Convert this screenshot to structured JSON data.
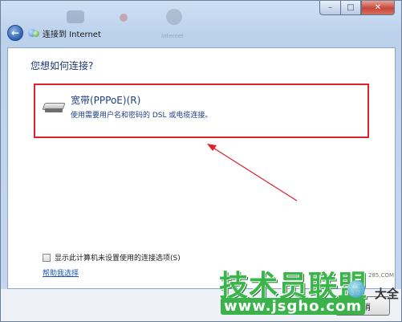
{
  "window": {
    "title": "连接到 Internet",
    "bg_label": "Internet",
    "controls": {
      "minimize": "–",
      "maximize": "□",
      "close": "✕"
    }
  },
  "nav": {
    "back_icon": "back-arrow-icon",
    "back_glyph": "←"
  },
  "content": {
    "question": "您想如何连接?",
    "option": {
      "title": "宽带(PPPoE)(R)",
      "description": "使用需要用户名和密码的 DSL 或电缆连接。",
      "icon": "modem-icon"
    },
    "checkbox_label": "显示此计算机未设置使用的连接选项(S)",
    "checkbox_checked": false,
    "help_link": "帮助我选择"
  },
  "footer": {
    "cancel_label": "取消"
  },
  "watermark": {
    "main": "技术员联盟",
    "url": "www.jsgho.com",
    "side": "大全",
    "small": "285.COM"
  },
  "colors": {
    "highlight_border": "#e0202a",
    "arrow": "#e0202a",
    "link": "#1a56b8",
    "watermark_green": "#3ab54a"
  }
}
